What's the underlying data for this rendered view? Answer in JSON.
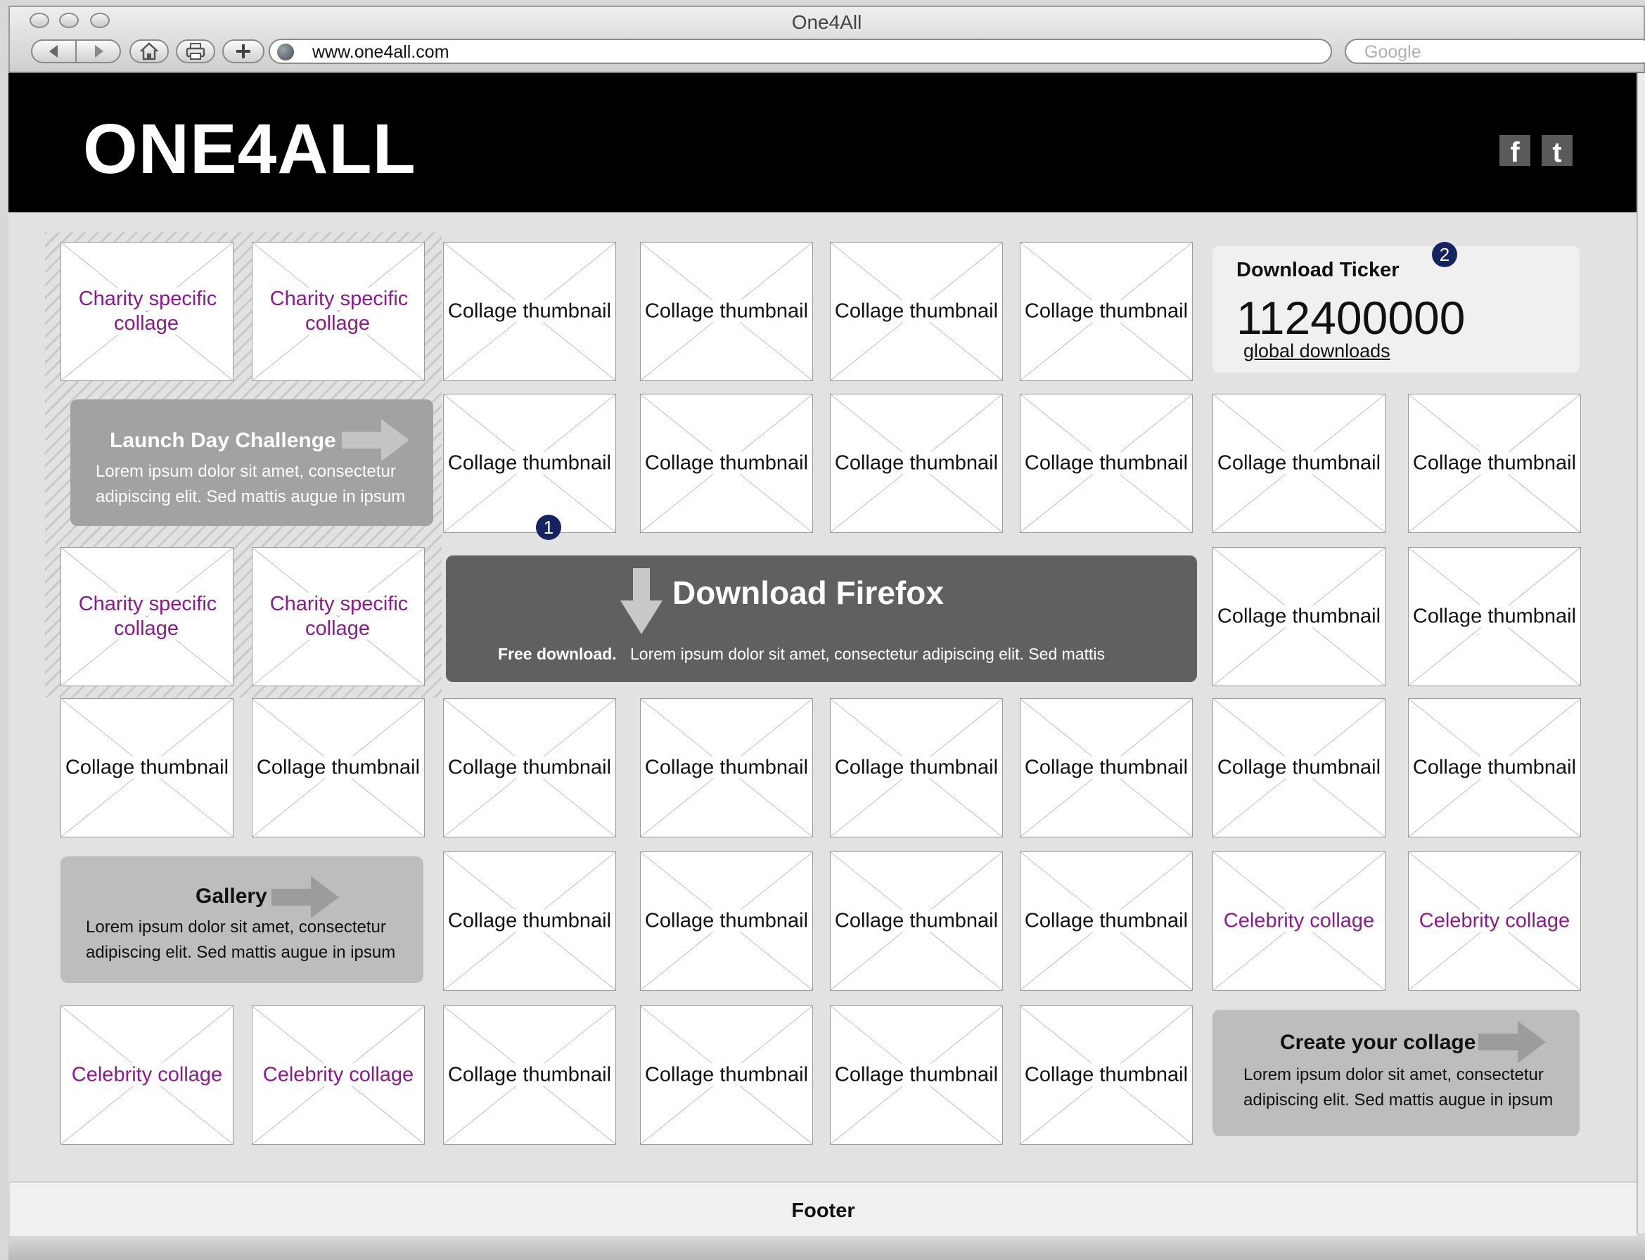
{
  "browser": {
    "title": "One4All",
    "url": "www.one4all.com",
    "search_placeholder": "Google"
  },
  "header": {
    "logo": "ONE4ALL",
    "facebook": "f",
    "twitter": "t"
  },
  "labels": {
    "collage_thumbnail": "Collage thumbnail",
    "charity_collage": "Charity specific collage",
    "celebrity_collage": "Celebrity collage"
  },
  "launch_challenge": {
    "title": "Launch Day Challenge",
    "body_line1": "Lorem ipsum dolor sit amet, consectetur",
    "body_line2": "adipiscing elit. Sed mattis augue in ipsum"
  },
  "download_firefox": {
    "title": "Download Firefox",
    "free_label": "Free download.",
    "body": "Lorem ipsum dolor sit amet, consectetur adipiscing elit. Sed mattis"
  },
  "ticker": {
    "title": "Download Ticker",
    "count": "112400000",
    "sub": "global downloads"
  },
  "gallery": {
    "title": "Gallery",
    "body_line1": "Lorem ipsum dolor sit amet, consectetur",
    "body_line2": "adipiscing elit. Sed mattis augue in ipsum"
  },
  "create_collage": {
    "title": "Create your collage",
    "body_line1": "Lorem ipsum dolor sit amet, consectetur",
    "body_line2": "adipiscing elit. Sed mattis augue in ipsum"
  },
  "badges": {
    "one": "1",
    "two": "2"
  },
  "footer": {
    "text": "Footer"
  },
  "tiles": [
    {
      "kind": "charity"
    },
    {
      "kind": "charity"
    },
    {
      "kind": "collage"
    },
    {
      "kind": "collage"
    },
    {
      "kind": "collage"
    },
    {
      "kind": "collage"
    },
    {
      "kind": "collage"
    },
    {
      "kind": "collage"
    },
    {
      "kind": "collage"
    },
    {
      "kind": "collage"
    },
    {
      "kind": "collage"
    },
    {
      "kind": "collage"
    },
    {
      "kind": "charity"
    },
    {
      "kind": "charity"
    },
    {
      "kind": "collage"
    },
    {
      "kind": "collage"
    },
    {
      "kind": "collage"
    },
    {
      "kind": "collage"
    },
    {
      "kind": "collage"
    },
    {
      "kind": "collage"
    },
    {
      "kind": "collage"
    },
    {
      "kind": "collage"
    },
    {
      "kind": "collage"
    },
    {
      "kind": "collage"
    },
    {
      "kind": "collage"
    },
    {
      "kind": "collage"
    },
    {
      "kind": "collage"
    },
    {
      "kind": "collage"
    },
    {
      "kind": "celebrity"
    },
    {
      "kind": "celebrity"
    },
    {
      "kind": "celebrity"
    },
    {
      "kind": "celebrity"
    },
    {
      "kind": "collage"
    },
    {
      "kind": "collage"
    },
    {
      "kind": "collage"
    },
    {
      "kind": "collage"
    }
  ],
  "colors": {
    "header_bg": "#000000",
    "purple_label": "#8c1a8c",
    "firefox_bg": "#5f605f",
    "badge": "#152461",
    "promo_grey": "#a2a2a2"
  }
}
